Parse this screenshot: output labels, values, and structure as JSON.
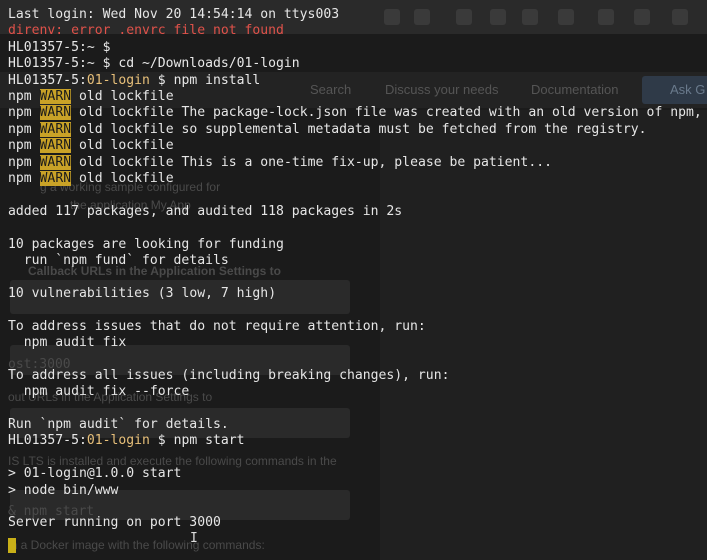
{
  "background": {
    "nav_links": [
      "Search",
      "Discuss your needs",
      "Documentation",
      "Ask G"
    ],
    "ghost_text": [
      "g a working sample configured for",
      "the application My App",
      "Callback URLs in the Application Settings to",
      "ost:3000",
      "out URLs in the Application Settings to",
      "IS LTS is installed and execute the following commands in the",
      "& npm start",
      "in a Docker image with the following commands:"
    ]
  },
  "terminal": {
    "lines": [
      {
        "parts": [
          {
            "text": "Last login: Wed Nov 20 14:54:14 on ttys003",
            "style": "plain"
          }
        ]
      },
      {
        "parts": [
          {
            "text": "direnv: error .envrc file not found",
            "style": "red"
          }
        ]
      },
      {
        "parts": [
          {
            "text": "HL01357-5:~ $",
            "style": "prompt"
          }
        ]
      },
      {
        "parts": [
          {
            "text": "HL01357-5:~ $ cd ~/Downloads/01-login",
            "style": "prompt"
          }
        ]
      },
      {
        "parts": [
          {
            "text": "HL01357-5:",
            "style": "prompt"
          },
          {
            "text": "01-login",
            "style": "dir"
          },
          {
            "text": " $ npm install",
            "style": "prompt"
          }
        ]
      },
      {
        "parts": [
          {
            "text": "npm ",
            "style": "plain"
          },
          {
            "text": "WARN",
            "style": "warn"
          },
          {
            "text": " old lockfile",
            "style": "plain"
          }
        ]
      },
      {
        "parts": [
          {
            "text": "npm ",
            "style": "plain"
          },
          {
            "text": "WARN",
            "style": "warn"
          },
          {
            "text": " old lockfile The package-lock.json file was created with an old version of npm,",
            "style": "plain"
          }
        ]
      },
      {
        "parts": [
          {
            "text": "npm ",
            "style": "plain"
          },
          {
            "text": "WARN",
            "style": "warn"
          },
          {
            "text": " old lockfile so supplemental metadata must be fetched from the registry.",
            "style": "plain"
          }
        ]
      },
      {
        "parts": [
          {
            "text": "npm ",
            "style": "plain"
          },
          {
            "text": "WARN",
            "style": "warn"
          },
          {
            "text": " old lockfile",
            "style": "plain"
          }
        ]
      },
      {
        "parts": [
          {
            "text": "npm ",
            "style": "plain"
          },
          {
            "text": "WARN",
            "style": "warn"
          },
          {
            "text": " old lockfile This is a one-time fix-up, please be patient...",
            "style": "plain"
          }
        ]
      },
      {
        "parts": [
          {
            "text": "npm ",
            "style": "plain"
          },
          {
            "text": "WARN",
            "style": "warn"
          },
          {
            "text": " old lockfile",
            "style": "plain"
          }
        ]
      },
      {
        "parts": [
          {
            "text": "",
            "style": "plain"
          }
        ]
      },
      {
        "parts": [
          {
            "text": "added 117 packages, and audited 118 packages in 2s",
            "style": "plain"
          }
        ]
      },
      {
        "parts": [
          {
            "text": "",
            "style": "plain"
          }
        ]
      },
      {
        "parts": [
          {
            "text": "10 packages are looking for funding",
            "style": "plain"
          }
        ]
      },
      {
        "parts": [
          {
            "text": "  run `npm fund` for details",
            "style": "plain"
          }
        ]
      },
      {
        "parts": [
          {
            "text": "",
            "style": "plain"
          }
        ]
      },
      {
        "parts": [
          {
            "text": "10 vulnerabilities (3 ",
            "style": "plain"
          },
          {
            "text": "low",
            "style": "plain"
          },
          {
            "text": ", 7 ",
            "style": "plain"
          },
          {
            "text": "high",
            "style": "plain"
          },
          {
            "text": ")",
            "style": "plain"
          }
        ]
      },
      {
        "parts": [
          {
            "text": "",
            "style": "plain"
          }
        ]
      },
      {
        "parts": [
          {
            "text": "To address issues that do not require attention, run:",
            "style": "plain"
          }
        ]
      },
      {
        "parts": [
          {
            "text": "  npm audit fix",
            "style": "plain"
          }
        ]
      },
      {
        "parts": [
          {
            "text": "",
            "style": "plain"
          }
        ]
      },
      {
        "parts": [
          {
            "text": "To address all issues (including breaking changes), run:",
            "style": "plain"
          }
        ]
      },
      {
        "parts": [
          {
            "text": "  npm audit fix --force",
            "style": "plain"
          }
        ]
      },
      {
        "parts": [
          {
            "text": "",
            "style": "plain"
          }
        ]
      },
      {
        "parts": [
          {
            "text": "Run `npm audit` for details.",
            "style": "plain"
          }
        ]
      },
      {
        "parts": [
          {
            "text": "HL01357-5:",
            "style": "prompt"
          },
          {
            "text": "01-login",
            "style": "dir"
          },
          {
            "text": " $ npm start",
            "style": "prompt"
          }
        ]
      },
      {
        "parts": [
          {
            "text": "",
            "style": "plain"
          }
        ]
      },
      {
        "parts": [
          {
            "text": "> 01-login@1.0.0 start",
            "style": "plain"
          }
        ]
      },
      {
        "parts": [
          {
            "text": "> node bin/www",
            "style": "plain"
          }
        ]
      },
      {
        "parts": [
          {
            "text": "",
            "style": "plain"
          }
        ]
      },
      {
        "parts": [
          {
            "text": "Server running on port 3000",
            "style": "plain"
          }
        ]
      }
    ]
  },
  "colors": {
    "terminal_bg": "#1b1b1b",
    "error_red": "#e0524a",
    "warn_badge": "#c9a227",
    "dir_accent": "#e8c07a"
  }
}
